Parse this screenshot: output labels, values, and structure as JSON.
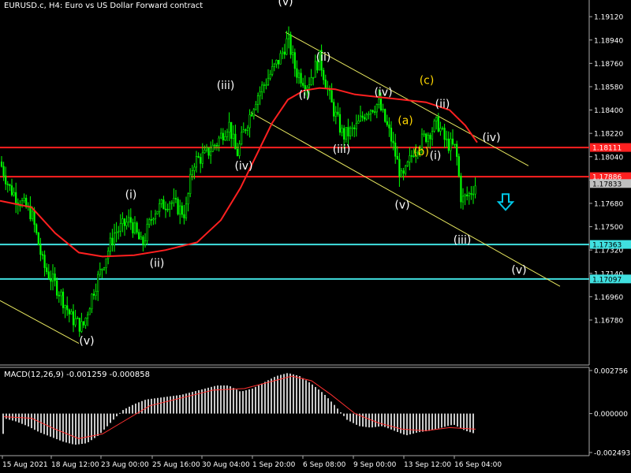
{
  "header": {
    "title": "EURUSD.c, H4:  Euro vs US Dollar Forward contract"
  },
  "macd": {
    "title": "MACD(12,26,9) -0.001259 -0.000858"
  },
  "colors": {
    "background": "#000000",
    "candle": "#00ff00",
    "moving_average": "#ff2020",
    "resistance": "#ff2020",
    "support": "#40e0e0",
    "channel": "#e8e860",
    "histogram": "#c8c8c8",
    "signal": "#ff3030",
    "label_white": "#ffffff",
    "label_yellow": "#ffd700",
    "arrow": "#00c8e8"
  },
  "chart_data": [
    {
      "type": "candlestick",
      "price_axis": {
        "ylim": [
          1.165,
          1.192
        ],
        "ticks": [
          "1.19120",
          "1.18940",
          "1.18760",
          "1.18580",
          "1.18400",
          "1.18220",
          "1.18040",
          "1.17860",
          "1.17680",
          "1.17500",
          "1.17320",
          "1.17140",
          "1.16960",
          "1.16780"
        ]
      },
      "time_labels": [
        "15 Aug 2021",
        "18 Aug 12:00",
        "23 Aug 00:00",
        "25 Aug 16:00",
        "30 Aug 04:00",
        "1 Sep 20:00",
        "6 Sep 08:00",
        "9 Sep 00:00",
        "13 Sep 12:00",
        "16 Sep 04:00"
      ],
      "price_series": [
        {
          "x": 0,
          "y": 1.18
        },
        {
          "x": 12,
          "y": 1.178
        },
        {
          "x": 25,
          "y": 1.177
        },
        {
          "x": 40,
          "y": 1.176
        },
        {
          "x": 55,
          "y": 1.172
        },
        {
          "x": 75,
          "y": 1.17
        },
        {
          "x": 90,
          "y": 1.168
        },
        {
          "x": 105,
          "y": 1.1672
        },
        {
          "x": 118,
          "y": 1.17
        },
        {
          "x": 130,
          "y": 1.172
        },
        {
          "x": 145,
          "y": 1.1745
        },
        {
          "x": 165,
          "y": 1.1755
        },
        {
          "x": 180,
          "y": 1.1735
        },
        {
          "x": 195,
          "y": 1.1762
        },
        {
          "x": 215,
          "y": 1.177
        },
        {
          "x": 235,
          "y": 1.176
        },
        {
          "x": 245,
          "y": 1.18
        },
        {
          "x": 260,
          "y": 1.1805
        },
        {
          "x": 275,
          "y": 1.1815
        },
        {
          "x": 290,
          "y": 1.183
        },
        {
          "x": 300,
          "y": 1.1805
        },
        {
          "x": 310,
          "y": 1.1825
        },
        {
          "x": 325,
          "y": 1.185
        },
        {
          "x": 340,
          "y": 1.1865
        },
        {
          "x": 355,
          "y": 1.188
        },
        {
          "x": 365,
          "y": 1.1895
        },
        {
          "x": 375,
          "y": 1.187
        },
        {
          "x": 390,
          "y": 1.186
        },
        {
          "x": 405,
          "y": 1.188
        },
        {
          "x": 420,
          "y": 1.1845
        },
        {
          "x": 435,
          "y": 1.182
        },
        {
          "x": 450,
          "y": 1.1825
        },
        {
          "x": 465,
          "y": 1.184
        },
        {
          "x": 480,
          "y": 1.1845
        },
        {
          "x": 495,
          "y": 1.182
        },
        {
          "x": 510,
          "y": 1.1785
        },
        {
          "x": 525,
          "y": 1.181
        },
        {
          "x": 540,
          "y": 1.182
        },
        {
          "x": 555,
          "y": 1.183
        },
        {
          "x": 565,
          "y": 1.1815
        },
        {
          "x": 578,
          "y": 1.181
        },
        {
          "x": 585,
          "y": 1.177
        },
        {
          "x": 595,
          "y": 1.1775
        },
        {
          "x": 603,
          "y": 1.1783
        }
      ],
      "moving_average": [
        {
          "x": 0,
          "y": 1.177
        },
        {
          "x": 40,
          "y": 1.1765
        },
        {
          "x": 70,
          "y": 1.1745
        },
        {
          "x": 100,
          "y": 1.173
        },
        {
          "x": 130,
          "y": 1.1727
        },
        {
          "x": 170,
          "y": 1.1728
        },
        {
          "x": 210,
          "y": 1.1732
        },
        {
          "x": 250,
          "y": 1.1738
        },
        {
          "x": 280,
          "y": 1.1755
        },
        {
          "x": 305,
          "y": 1.178
        },
        {
          "x": 325,
          "y": 1.1805
        },
        {
          "x": 345,
          "y": 1.183
        },
        {
          "x": 365,
          "y": 1.1848
        },
        {
          "x": 385,
          "y": 1.1855
        },
        {
          "x": 405,
          "y": 1.1857
        },
        {
          "x": 425,
          "y": 1.1856
        },
        {
          "x": 450,
          "y": 1.1852
        },
        {
          "x": 480,
          "y": 1.185
        },
        {
          "x": 510,
          "y": 1.1848
        },
        {
          "x": 540,
          "y": 1.1846
        },
        {
          "x": 570,
          "y": 1.184
        },
        {
          "x": 590,
          "y": 1.1828
        },
        {
          "x": 605,
          "y": 1.1815
        }
      ],
      "horizontal_levels": [
        {
          "price": 1.18111,
          "label": "1.18111",
          "kind": "resistance"
        },
        {
          "price": 1.17886,
          "label": "1.17886",
          "kind": "resistance"
        },
        {
          "price": 1.17833,
          "label": "1.17833",
          "kind": "current"
        },
        {
          "price": 1.17363,
          "label": "1.17363",
          "kind": "support"
        },
        {
          "price": 1.17097,
          "label": "1.17097",
          "kind": "support"
        }
      ],
      "channel_lines": [
        {
          "x1": 0,
          "y1": 1.1693,
          "x2": 100,
          "y2": 1.166
        },
        {
          "x1": 362,
          "y1": 1.19,
          "x2": 670,
          "y2": 1.1797
        },
        {
          "x1": 318,
          "y1": 1.1838,
          "x2": 710,
          "y2": 1.1704
        }
      ],
      "wave_labels": [
        {
          "text": "(v)",
          "x": 362,
          "y": 1.1921,
          "color": "white"
        },
        {
          "text": "(ii)",
          "x": 410,
          "y": 1.1878,
          "color": "white"
        },
        {
          "text": "(iii)",
          "x": 286,
          "y": 1.1856,
          "color": "white"
        },
        {
          "text": "(i)",
          "x": 386,
          "y": 1.1849,
          "color": "white"
        },
        {
          "text": "(iv)",
          "x": 486,
          "y": 1.1851,
          "color": "white"
        },
        {
          "text": "(c)",
          "x": 541,
          "y": 1.186,
          "color": "yellow"
        },
        {
          "text": "(ii)",
          "x": 561,
          "y": 1.1842,
          "color": "white"
        },
        {
          "text": "(a)",
          "x": 514,
          "y": 1.1829,
          "color": "yellow"
        },
        {
          "text": "(iv)",
          "x": 623,
          "y": 1.1816,
          "color": "white"
        },
        {
          "text": "(iii)",
          "x": 433,
          "y": 1.1807,
          "color": "white"
        },
        {
          "text": "(b)",
          "x": 534,
          "y": 1.1805,
          "color": "yellow"
        },
        {
          "text": "(i)",
          "x": 552,
          "y": 1.1802,
          "color": "white"
        },
        {
          "text": "(iv)",
          "x": 309,
          "y": 1.1794,
          "color": "white"
        },
        {
          "text": "(i)",
          "x": 166,
          "y": 1.1772,
          "color": "white"
        },
        {
          "text": "(v)",
          "x": 510,
          "y": 1.1764,
          "color": "white"
        },
        {
          "text": "(iii)",
          "x": 586,
          "y": 1.1737,
          "color": "white"
        },
        {
          "text": "(ii)",
          "x": 199,
          "y": 1.1719,
          "color": "white"
        },
        {
          "text": "(v)",
          "x": 658,
          "y": 1.1714,
          "color": "white"
        },
        {
          "text": "(v)",
          "x": 110,
          "y": 1.1659,
          "color": "white"
        }
      ],
      "arrow": {
        "x": 641,
        "y": 1.1769,
        "direction": "down"
      }
    },
    {
      "type": "bar",
      "name": "MACD(12,26,9)",
      "ylim": [
        -0.002493,
        0.002756
      ],
      "ticks": [
        "0.002756",
        "0.000000",
        "-0.002493"
      ],
      "histogram": [
        {
          "x": 5,
          "y": -0.0003
        },
        {
          "x": 20,
          "y": -0.0005
        },
        {
          "x": 35,
          "y": -0.0008
        },
        {
          "x": 50,
          "y": -0.0012
        },
        {
          "x": 65,
          "y": -0.0015
        },
        {
          "x": 80,
          "y": -0.0018
        },
        {
          "x": 95,
          "y": -0.002
        },
        {
          "x": 110,
          "y": -0.0019
        },
        {
          "x": 125,
          "y": -0.0014
        },
        {
          "x": 140,
          "y": -0.0006
        },
        {
          "x": 155,
          "y": 0.0002
        },
        {
          "x": 170,
          "y": 0.0006
        },
        {
          "x": 185,
          "y": 0.0009
        },
        {
          "x": 200,
          "y": 0.001
        },
        {
          "x": 215,
          "y": 0.0011
        },
        {
          "x": 230,
          "y": 0.0012
        },
        {
          "x": 245,
          "y": 0.0014
        },
        {
          "x": 260,
          "y": 0.0016
        },
        {
          "x": 275,
          "y": 0.0018
        },
        {
          "x": 290,
          "y": 0.0018
        },
        {
          "x": 305,
          "y": 0.0014
        },
        {
          "x": 320,
          "y": 0.0016
        },
        {
          "x": 335,
          "y": 0.002
        },
        {
          "x": 350,
          "y": 0.0024
        },
        {
          "x": 365,
          "y": 0.0026
        },
        {
          "x": 380,
          "y": 0.0024
        },
        {
          "x": 395,
          "y": 0.0019
        },
        {
          "x": 410,
          "y": 0.0013
        },
        {
          "x": 425,
          "y": 0.0005
        },
        {
          "x": 440,
          "y": -0.0004
        },
        {
          "x": 455,
          "y": -0.0008
        },
        {
          "x": 470,
          "y": -0.0009
        },
        {
          "x": 485,
          "y": -0.0008
        },
        {
          "x": 500,
          "y": -0.0011
        },
        {
          "x": 515,
          "y": -0.0014
        },
        {
          "x": 530,
          "y": -0.0012
        },
        {
          "x": 545,
          "y": -0.0011
        },
        {
          "x": 560,
          "y": -0.0009
        },
        {
          "x": 575,
          "y": -0.0007
        },
        {
          "x": 590,
          "y": -0.0011
        },
        {
          "x": 603,
          "y": -0.0013
        }
      ],
      "signal": [
        {
          "x": 5,
          "y": -0.0002
        },
        {
          "x": 40,
          "y": -0.0003
        },
        {
          "x": 70,
          "y": -0.001
        },
        {
          "x": 100,
          "y": -0.0016
        },
        {
          "x": 130,
          "y": -0.0013
        },
        {
          "x": 160,
          "y": -0.0004
        },
        {
          "x": 190,
          "y": 0.0005
        },
        {
          "x": 230,
          "y": 0.001
        },
        {
          "x": 270,
          "y": 0.0015
        },
        {
          "x": 310,
          "y": 0.0016
        },
        {
          "x": 340,
          "y": 0.002
        },
        {
          "x": 370,
          "y": 0.0024
        },
        {
          "x": 395,
          "y": 0.0021
        },
        {
          "x": 420,
          "y": 0.0012
        },
        {
          "x": 450,
          "y": 0.0
        },
        {
          "x": 480,
          "y": -0.0006
        },
        {
          "x": 510,
          "y": -0.001
        },
        {
          "x": 540,
          "y": -0.0011
        },
        {
          "x": 570,
          "y": -0.0009
        },
        {
          "x": 603,
          "y": -0.001
        }
      ]
    }
  ]
}
